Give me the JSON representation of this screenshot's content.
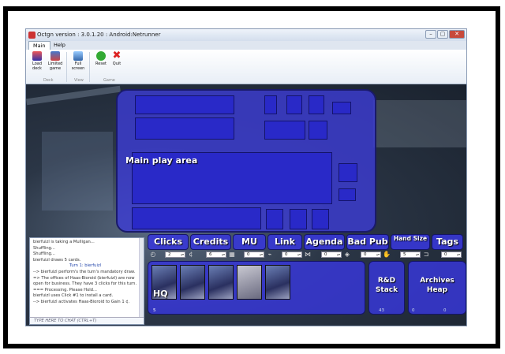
{
  "window": {
    "title": "Octgn  version : 3.0.1.20 : Android:Netrunner",
    "minimize": "–",
    "maximize": "▢",
    "close": "✕"
  },
  "menu": {
    "tabs": [
      "Main",
      "Help"
    ]
  },
  "ribbon": {
    "buttons": {
      "load_deck": "Load deck",
      "limited_game": "Limited game",
      "full_screen": "Full screen",
      "reset": "Reset",
      "quit": "Quit"
    },
    "groups": {
      "deck": "Deck",
      "view": "View",
      "game": "Game"
    }
  },
  "play_area": {
    "main_label": "Main play area"
  },
  "counters": {
    "labels": {
      "clicks": "Clicks",
      "credits": "Credits",
      "mu": "MU",
      "link": "Link",
      "agenda": "Agenda",
      "bad_pub": "Bad Pub",
      "hand_size": "Hand Size",
      "tags": "Tags"
    },
    "values": {
      "clicks": "2",
      "credits": "6",
      "mu": "0",
      "link": "0",
      "agenda": "0",
      "bad_pub": "0",
      "hand_size": "5",
      "tags": "0"
    }
  },
  "chat": {
    "lines": [
      "bierfuizl is taking a Mulligan...",
      "Shuffling...",
      "Shuffling...",
      "bierfuizl draws 5 cards."
    ],
    "turn_marker": "Turn 1: bierfuizl",
    "lines_after": [
      "--> bierfuizl perform's the turn's mandatory draw.",
      "=> The offices of Haas-Bioroid (bierfuizl) are now open for business. They have 3 clicks for this turn.",
      "=== Processing. Please Hold...",
      "bierfuizl uses Click #1 to install a card.",
      "--> bierfuizl activates Haas-Bioroid to Gain 1 ¢."
    ],
    "input_placeholder": "TYPE HERE TO CHAT (CTRL+T)"
  },
  "hq": {
    "label": "HQ",
    "count": "5"
  },
  "rd_stack": {
    "label": "R&D Stack",
    "count": "43"
  },
  "archives": {
    "label": "Archives Heap",
    "count_hidden": "0",
    "count": "0"
  }
}
